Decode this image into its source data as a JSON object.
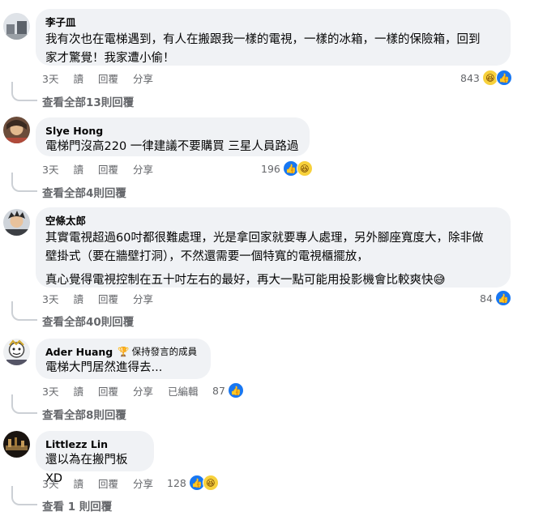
{
  "comments": [
    {
      "author": "李子皿",
      "text": "我有次也在電梯遇到，有人在搬跟我一樣的電視，一樣的冰箱，一樣的保險箱，回到\n家才驚覺！我家遭小偷！",
      "time": "3天",
      "read": "讀",
      "reply": "回覆",
      "share": "分享",
      "reaction_count": "843",
      "reactions": [
        "haha-icon",
        "like-icon"
      ],
      "view_replies": "查看全部13則回覆"
    },
    {
      "author": "Slye Hong",
      "text": "電梯門沒高220 一律建議不要購買 三星人員路過",
      "time": "3天",
      "read": "讀",
      "reply": "回覆",
      "share": "分享",
      "reaction_count": "196",
      "reactions": [
        "like-icon",
        "haha-icon"
      ],
      "view_replies": "查看全部4則回覆"
    },
    {
      "author": "空條太郎",
      "text": "其實電視超過60吋都很難處理，光是拿回家就要專人處理，另外腳座寬度大，除非做\n壁掛式（要在牆壁打洞），不然還需要一個特寬的電視櫃擺放，",
      "text2": "真心覺得電視控制在五十吋左右的最好，再大一點可能用投影機會比較爽快😅",
      "time": "3天",
      "read": "讀",
      "reply": "回覆",
      "share": "分享",
      "reaction_count": "84",
      "reactions": [
        "like-icon"
      ],
      "view_replies": "查看全部40則回覆"
    },
    {
      "author": "Ader Huang",
      "badge": "保持發言的成員",
      "text": "電梯大門居然進得去...",
      "time": "3天",
      "read": "讀",
      "reply": "回覆",
      "share": "分享",
      "edited": "已編輯",
      "reaction_count": "87",
      "reactions": [
        "like-icon"
      ],
      "view_replies": "查看全部8則回覆"
    },
    {
      "author": "Littlezz Lin",
      "text": "還以為在搬門板XD",
      "time": "3天",
      "read": "讀",
      "reply": "回覆",
      "share": "分享",
      "reaction_count": "128",
      "reactions": [
        "like-icon",
        "haha-icon"
      ],
      "view_replies": "查看 1 則回覆"
    }
  ]
}
